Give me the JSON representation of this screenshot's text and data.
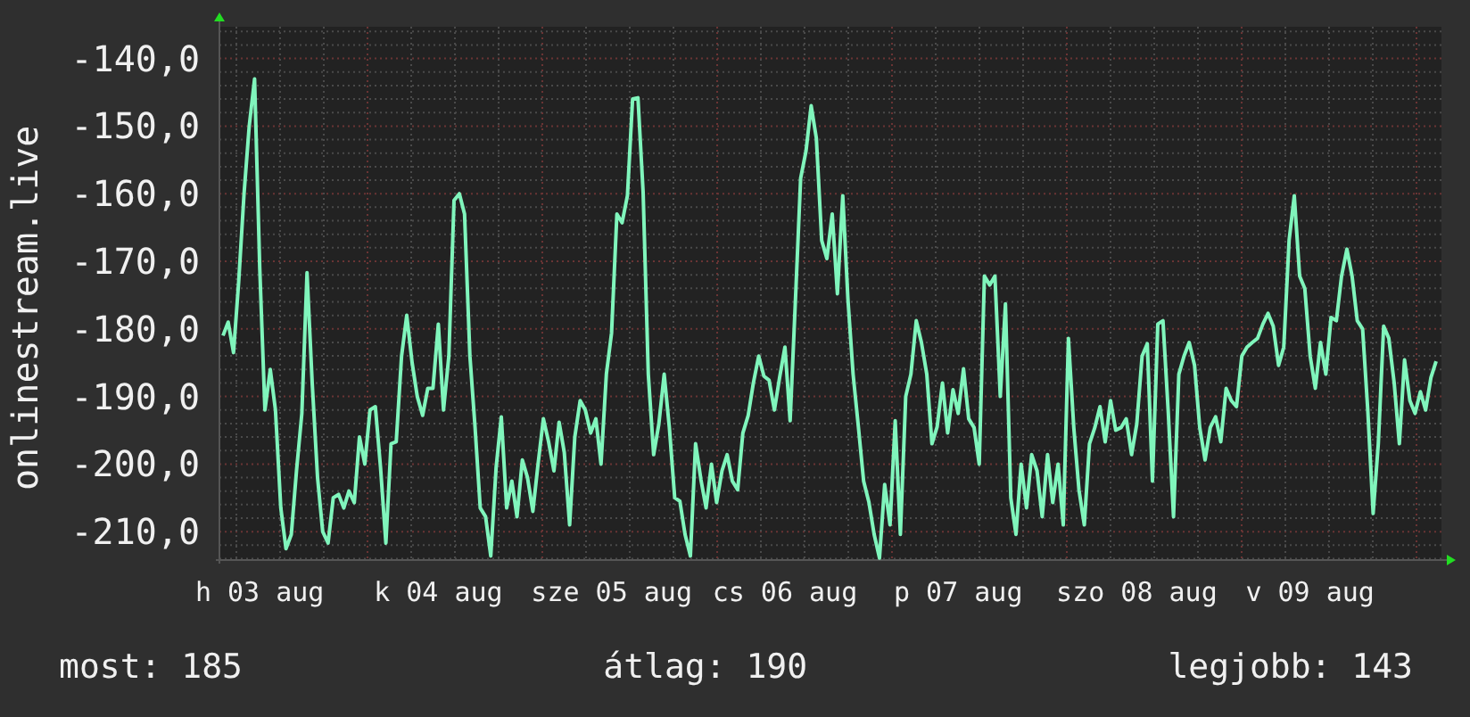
{
  "chart": {
    "chart_data": {
      "type": "line",
      "ylabel": "onlinestream.live",
      "ylim": [
        -214.2,
        -135.3
      ],
      "grid": true,
      "categories": [
        null,
        null,
        null,
        null,
        null,
        null,
        null,
        "h 03 aug",
        null,
        null,
        null,
        null,
        null,
        null,
        null,
        null,
        null,
        null,
        null,
        null,
        null,
        null,
        null,
        null,
        null,
        null,
        null,
        null,
        null,
        null,
        null,
        null,
        null,
        null,
        null,
        null,
        null,
        null,
        null,
        null,
        null,
        "k 04 aug",
        null,
        null,
        null,
        null,
        null,
        null,
        null,
        null,
        null,
        null,
        null,
        null,
        null,
        null,
        null,
        null,
        null,
        null,
        null,
        null,
        null,
        null,
        null,
        null,
        null,
        null,
        null,
        null,
        null,
        null,
        null,
        null,
        "sze 05 aug",
        null,
        null,
        null,
        null,
        null,
        null,
        null,
        null,
        null,
        null,
        null,
        null,
        null,
        null,
        null,
        null,
        null,
        null,
        null,
        null,
        null,
        null,
        null,
        null,
        null,
        null,
        null,
        null,
        null,
        null,
        null,
        null,
        "cs 06 aug",
        null,
        null,
        null,
        null,
        null,
        null,
        null,
        null,
        null,
        null,
        null,
        null,
        null,
        null,
        null,
        null,
        null,
        null,
        null,
        null,
        null,
        null,
        null,
        null,
        null,
        null,
        null,
        null,
        null,
        null,
        null,
        null,
        "p 07 aug",
        null,
        null,
        null,
        null,
        null,
        null,
        null,
        null,
        null,
        null,
        null,
        null,
        null,
        null,
        null,
        null,
        null,
        null,
        null,
        null,
        null,
        null,
        null,
        null,
        null,
        null,
        null,
        null,
        null,
        null,
        null,
        null,
        null,
        "szo 08 aug",
        null,
        null,
        null,
        null,
        null,
        null,
        null,
        null,
        null,
        null,
        null,
        null,
        null,
        null,
        null,
        null,
        null,
        null,
        null,
        null,
        null,
        null,
        null,
        null,
        null,
        null,
        null,
        null,
        null,
        null,
        null,
        null,
        "v 09 aug",
        null,
        null,
        null,
        null,
        null,
        null,
        null,
        null,
        null,
        null,
        null,
        null,
        null,
        null,
        null,
        null,
        null,
        null,
        null,
        null,
        null,
        null,
        null,
        null
      ],
      "yticks": [
        {
          "value": -140,
          "label": "-140,0"
        },
        {
          "value": -150,
          "label": "-150,0"
        },
        {
          "value": -160,
          "label": "-160,0"
        },
        {
          "value": -170,
          "label": "-170,0"
        },
        {
          "value": -180,
          "label": "-180,0"
        },
        {
          "value": -190,
          "label": "-190,0"
        },
        {
          "value": -200,
          "label": "-200,0"
        },
        {
          "value": -210,
          "label": "-210,0"
        }
      ],
      "series": [
        {
          "color": "#80f5bc",
          "values": [
            -181,
            -179,
            -183.5,
            -173,
            -160,
            -150,
            -143,
            -171,
            -192,
            -186,
            -192,
            -206.5,
            -212.5,
            -210.4,
            -201,
            -192.5,
            -171.7,
            -188,
            -202,
            -210,
            -211.7,
            -205,
            -204.5,
            -206.5,
            -204,
            -205.7,
            -196,
            -200,
            -192,
            -191.5,
            -200.5,
            -211.7,
            -197,
            -196.7,
            -184,
            -178,
            -185,
            -190,
            -192.8,
            -188.8,
            -188.8,
            -179.3,
            -192,
            -184,
            -161,
            -160,
            -163,
            -184,
            -194.6,
            -206.5,
            -207.8,
            -213.6,
            -200.5,
            -193,
            -206.5,
            -202.5,
            -207.8,
            -199.4,
            -202,
            -207,
            -200,
            -193.3,
            -196.7,
            -201,
            -193.8,
            -198.3,
            -209,
            -196,
            -190.6,
            -192,
            -195.4,
            -193.3,
            -200,
            -186.7,
            -180.6,
            -163,
            -164.3,
            -160.3,
            -146,
            -145.8,
            -159.8,
            -186.7,
            -198.6,
            -194.1,
            -186.7,
            -194.6,
            -205,
            -205.5,
            -210.4,
            -213.6,
            -197,
            -202.3,
            -206.5,
            -200,
            -205.7,
            -201,
            -198.6,
            -202.5,
            -203.8,
            -195.4,
            -192.8,
            -188,
            -184,
            -187,
            -187.6,
            -192,
            -187.2,
            -182.7,
            -193.6,
            -175.6,
            -157.7,
            -153.7,
            -147,
            -151.8,
            -166.9,
            -169.6,
            -163,
            -174.8,
            -160.3,
            -175.6,
            -186.7,
            -194.6,
            -202.5,
            -205.7,
            -210.4,
            -213.9,
            -203,
            -209,
            -193.6,
            -210.4,
            -190,
            -186.7,
            -178.8,
            -182,
            -186.7,
            -197,
            -194.5,
            -188,
            -195.4,
            -189,
            -192.5,
            -185.9,
            -193.3,
            -194.6,
            -200,
            -172.2,
            -173.5,
            -172.2,
            -190,
            -176.3,
            -205,
            -210.4,
            -200,
            -206.5,
            -198.6,
            -201,
            -207.8,
            -198.6,
            -205.7,
            -200,
            -209,
            -181.4,
            -194.6,
            -203.8,
            -209,
            -197,
            -194.6,
            -191.5,
            -196.7,
            -190.6,
            -195,
            -194.6,
            -193.3,
            -198.6,
            -194.1,
            -184,
            -182.2,
            -202.5,
            -179.3,
            -178.8,
            -192.5,
            -207.8,
            -186.7,
            -184,
            -182,
            -185.4,
            -194.6,
            -199.4,
            -194.6,
            -193,
            -196.7,
            -188.8,
            -190.6,
            -191.5,
            -184,
            -182.7,
            -182,
            -181.4,
            -179.3,
            -177.7,
            -179.6,
            -185.4,
            -182.7,
            -166.9,
            -160.3,
            -172.2,
            -174,
            -184,
            -188.8,
            -182,
            -186.7,
            -178.3,
            -178.8,
            -172.2,
            -168.2,
            -172.2,
            -178.8,
            -180,
            -192,
            -207.3,
            -197,
            -179.6,
            -181.4,
            -188,
            -197,
            -184.6,
            -190.6,
            -192.5,
            -189.3,
            -192,
            -187.2,
            -184.8
          ]
        }
      ]
    }
  },
  "stats": [
    "most: 185",
    "átlag: 190",
    "legjobb: 143"
  ]
}
